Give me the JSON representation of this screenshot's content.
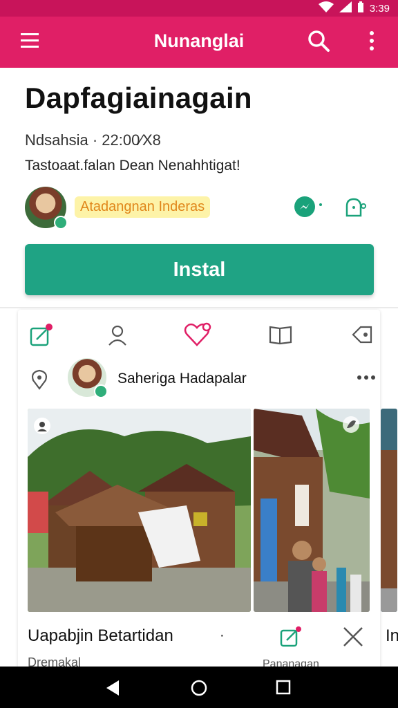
{
  "status_bar": {
    "time": "3:39"
  },
  "app_bar": {
    "title": "Nunanglai"
  },
  "app": {
    "name": "Dapfagiainagain",
    "meta": "Ndsahsia · 22:00⁄X8",
    "tagline": "Tastoaat.falan Dean Nenahhtigat!",
    "developer": "Atadangnan Inderas",
    "install_label": "Instal"
  },
  "post": {
    "author": "Saheriga Hadapalar",
    "caption": "Uapabjin Betartidan",
    "caption_dot": "·",
    "next_caption": "In",
    "sub_left": "Dremakal",
    "sub_right": "Pananagan"
  },
  "icons": {
    "menu": "menu-icon",
    "search": "search-icon",
    "more": "more-vert-icon",
    "messenger": "messenger-icon",
    "share": "share-icon",
    "tab1": "edit-note-icon",
    "tab2": "profile-icon",
    "tab3": "heart-icon",
    "tab4": "book-icon",
    "tab5": "tag-icon",
    "location": "location-pin-icon",
    "post_more": "more-horiz-icon",
    "photo_badge": "camera-badge-icon",
    "edit": "edit-icon",
    "close": "close-icon",
    "nav_back": "back-icon",
    "nav_home": "home-icon",
    "nav_recents": "recents-icon"
  },
  "colors": {
    "status_bar": "#c8145a",
    "app_bar": "#e01f66",
    "install": "#1fa384",
    "accent_green": "#1aa27a",
    "accent_pink": "#e01f66",
    "dev_name_bg": "#fdf3a8",
    "dev_name_text": "#e0861a"
  }
}
